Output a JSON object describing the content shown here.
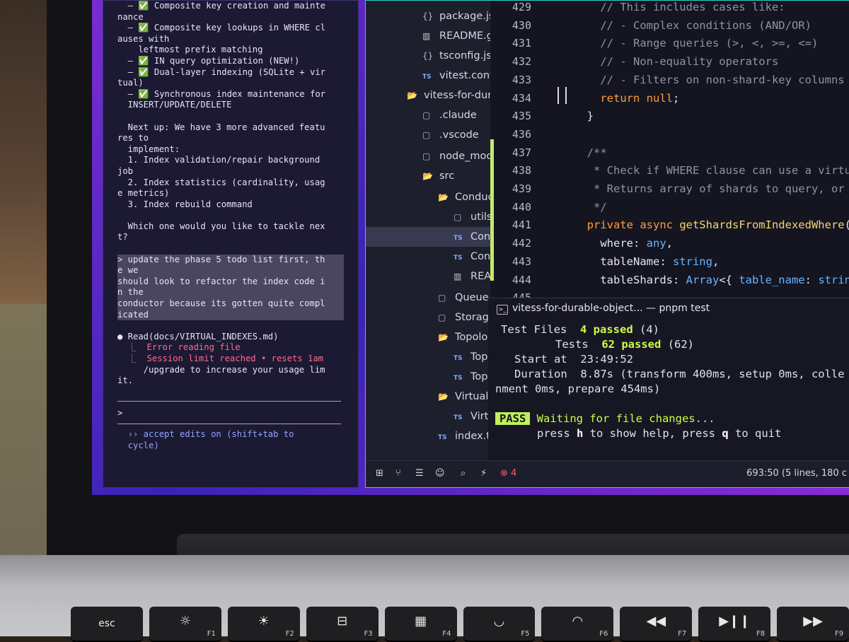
{
  "claude_terminal": {
    "lines": [
      {
        "t": "  – ✅ Composite key creation and mainte",
        "c": ""
      },
      {
        "t": "nance",
        "c": ""
      },
      {
        "t": "  – ✅ Composite key lookups in WHERE cl",
        "c": ""
      },
      {
        "t": "auses with",
        "c": ""
      },
      {
        "t": "    leftmost prefix matching",
        "c": ""
      },
      {
        "t": "  – ✅ IN query optimization (NEW!)",
        "c": ""
      },
      {
        "t": "  – ✅ Dual-layer indexing (SQLite + vir",
        "c": ""
      },
      {
        "t": "tual)",
        "c": ""
      },
      {
        "t": "  – ✅ Synchronous index maintenance for",
        "c": ""
      },
      {
        "t": "  INSERT/UPDATE/DELETE",
        "c": ""
      },
      {
        "t": "",
        "c": ""
      },
      {
        "t": "  Next up: We have 3 more advanced featu",
        "c": ""
      },
      {
        "t": "res to",
        "c": ""
      },
      {
        "t": "  implement:",
        "c": ""
      },
      {
        "t": "  1. Index validation/repair background",
        "c": ""
      },
      {
        "t": "job",
        "c": ""
      },
      {
        "t": "  2. Index statistics (cardinality, usag",
        "c": ""
      },
      {
        "t": "e metrics)",
        "c": ""
      },
      {
        "t": "  3. Index rebuild command",
        "c": ""
      },
      {
        "t": "",
        "c": ""
      },
      {
        "t": "  Which one would you like to tackle nex",
        "c": ""
      },
      {
        "t": "t?",
        "c": ""
      },
      {
        "t": "",
        "c": ""
      },
      {
        "t": "> update the phase 5 todo list first, th",
        "c": "hl"
      },
      {
        "t": "e we",
        "c": "hl"
      },
      {
        "t": "should look to refactor the index code i",
        "c": "hl"
      },
      {
        "t": "n the",
        "c": "hl"
      },
      {
        "t": "conductor because its gotten quite compl",
        "c": "hl"
      },
      {
        "t": "icated",
        "c": "hl"
      },
      {
        "t": "",
        "c": ""
      },
      {
        "t": "● Read(docs/VIRTUAL_INDEXES.md)",
        "c": ""
      },
      {
        "t": "  ⎿  Error reading file",
        "c": "red"
      },
      {
        "t": "  ⎿  Session limit reached • resets 1am",
        "c": "red"
      },
      {
        "t": "     /upgrade to increase your usage lim",
        "c": ""
      },
      {
        "t": "it.",
        "c": ""
      }
    ],
    "prompt": ">",
    "footer_1": "  ›› accept edits on (shift+tab to",
    "footer_2": "  cycle)"
  },
  "explorer": {
    "items": [
      {
        "label": "package.js",
        "icon": "{}",
        "kind": "json",
        "depth": 1
      },
      {
        "label": "README.g",
        "icon": "▥",
        "kind": "book",
        "depth": 1
      },
      {
        "label": "tsconfig.js",
        "icon": "{}",
        "kind": "json",
        "depth": 1
      },
      {
        "label": "vitest.conf",
        "icon": "TS",
        "kind": "ts",
        "depth": 1
      },
      {
        "label": "vitess-for-dura",
        "icon": "📂",
        "kind": "fold",
        "depth": 0
      },
      {
        "label": ".claude",
        "icon": "▢",
        "kind": "folder",
        "depth": 1
      },
      {
        "label": ".vscode",
        "icon": "▢",
        "kind": "folder",
        "depth": 1
      },
      {
        "label": "node_mod",
        "icon": "▢",
        "kind": "folder",
        "depth": 1
      },
      {
        "label": "src",
        "icon": "📂",
        "kind": "fold",
        "depth": 1
      },
      {
        "label": "Conduc",
        "icon": "📂",
        "kind": "fold",
        "depth": 2
      },
      {
        "label": "utils",
        "icon": "▢",
        "kind": "folder",
        "depth": 3
      },
      {
        "label": "Con",
        "icon": "TS",
        "kind": "ts",
        "depth": 3
      },
      {
        "label": "Con",
        "icon": "TS",
        "kind": "ts",
        "depth": 3
      },
      {
        "label": "REA",
        "icon": "▥",
        "kind": "book",
        "depth": 3
      },
      {
        "label": "Queue",
        "icon": "▢",
        "kind": "folder",
        "depth": 2
      },
      {
        "label": "Storage",
        "icon": "▢",
        "kind": "folder",
        "depth": 2
      },
      {
        "label": "Topolo",
        "icon": "📂",
        "kind": "fold",
        "depth": 2
      },
      {
        "label": "Topo",
        "icon": "TS",
        "kind": "ts",
        "depth": 3
      },
      {
        "label": "Topo",
        "icon": "TS",
        "kind": "ts",
        "depth": 3
      },
      {
        "label": "VirtualI",
        "icon": "📂",
        "kind": "fold",
        "depth": 2
      },
      {
        "label": "Virtu",
        "icon": "TS",
        "kind": "ts",
        "depth": 3
      },
      {
        "label": "index.ts",
        "icon": "TS",
        "kind": "ts",
        "depth": 2
      }
    ]
  },
  "editor": {
    "line_numbers": [
      "429",
      "430",
      "431",
      "432",
      "433",
      "434",
      "435",
      "436",
      "437",
      "438",
      "439",
      "440",
      "441",
      "442",
      "443",
      "444",
      "445"
    ],
    "lines": [
      [
        [
          "cm",
          "    // This includes cases like:"
        ]
      ],
      [
        [
          "cm",
          "    // - Complex conditions (AND/OR)"
        ]
      ],
      [
        [
          "cm",
          "    // - Range queries (>, <, >=, <=)"
        ]
      ],
      [
        [
          "cm",
          "    // - Non-equality operators"
        ]
      ],
      [
        [
          "cm",
          "    // - Filters on non-shard-key columns"
        ]
      ],
      [
        [
          "kw",
          "    return "
        ],
        [
          "kw",
          "null"
        ],
        [
          "pl",
          ";"
        ]
      ],
      [
        [
          "pl",
          "  }"
        ]
      ],
      [
        [
          "pl",
          ""
        ]
      ],
      [
        [
          "cm",
          "  /**"
        ]
      ],
      [
        [
          "cm",
          "   * Check if WHERE clause can use a virtual"
        ]
      ],
      [
        [
          "cm",
          "   * Returns array of shards to query, or n"
        ]
      ],
      [
        [
          "cm",
          "   */"
        ]
      ],
      [
        [
          "kw",
          "  private async "
        ],
        [
          "fnc",
          "getShardsFromIndexedWhere"
        ],
        [
          "pl",
          "("
        ]
      ],
      [
        [
          "pl",
          "    where: "
        ],
        [
          "ty",
          "any"
        ],
        [
          "pl",
          ","
        ]
      ],
      [
        [
          "pl",
          "    tableName: "
        ],
        [
          "ty",
          "string"
        ],
        [
          "pl",
          ","
        ]
      ],
      [
        [
          "pl",
          "    tableShards: "
        ],
        [
          "ty",
          "Array"
        ],
        [
          "pl",
          "<{ "
        ],
        [
          "ty",
          "table_name"
        ],
        [
          "pl",
          ": "
        ],
        [
          "ty",
          "string"
        ]
      ],
      [
        [
          "pl",
          "        "
        ]
      ]
    ]
  },
  "terminal": {
    "tab_title": "vitess-for-durable-object... — pnpm test",
    "test_files_label": "Test Files",
    "test_files_value": "4 passed",
    "test_files_count": "(4)",
    "tests_label": "Tests",
    "tests_value": "62 passed",
    "tests_count": "(62)",
    "start_label": "Start at",
    "start_value": "23:49:52",
    "duration_label": "Duration",
    "duration_value": "8.87s (transform 400ms, setup 0ms, colle",
    "duration_wrap": "nment 0ms, prepare 454ms)",
    "pass_badge": "PASS",
    "waiting": "Waiting for file changes...",
    "help_pre": "press ",
    "help_h": "h",
    "help_mid": " to show help, press ",
    "help_q": "q",
    "help_post": " to quit"
  },
  "status_bar": {
    "errors": "4",
    "position": "693:50 (5 lines, 180 c"
  },
  "keyboard": [
    {
      "glyph": "esc",
      "fn": ""
    },
    {
      "glyph": "☼",
      "fn": "F1"
    },
    {
      "glyph": "☀",
      "fn": "F2"
    },
    {
      "glyph": "⊟",
      "fn": "F3"
    },
    {
      "glyph": "▦",
      "fn": "F4"
    },
    {
      "glyph": "◡",
      "fn": "F5"
    },
    {
      "glyph": "◠",
      "fn": "F6"
    },
    {
      "glyph": "◀◀",
      "fn": "F7"
    },
    {
      "glyph": "▶❙❙",
      "fn": "F8"
    },
    {
      "glyph": "▶▶",
      "fn": "F9"
    }
  ],
  "colors": {
    "accent_green": "#cdfb4b",
    "error_red": "#ff5a6a",
    "editor_bg": "#141521"
  }
}
